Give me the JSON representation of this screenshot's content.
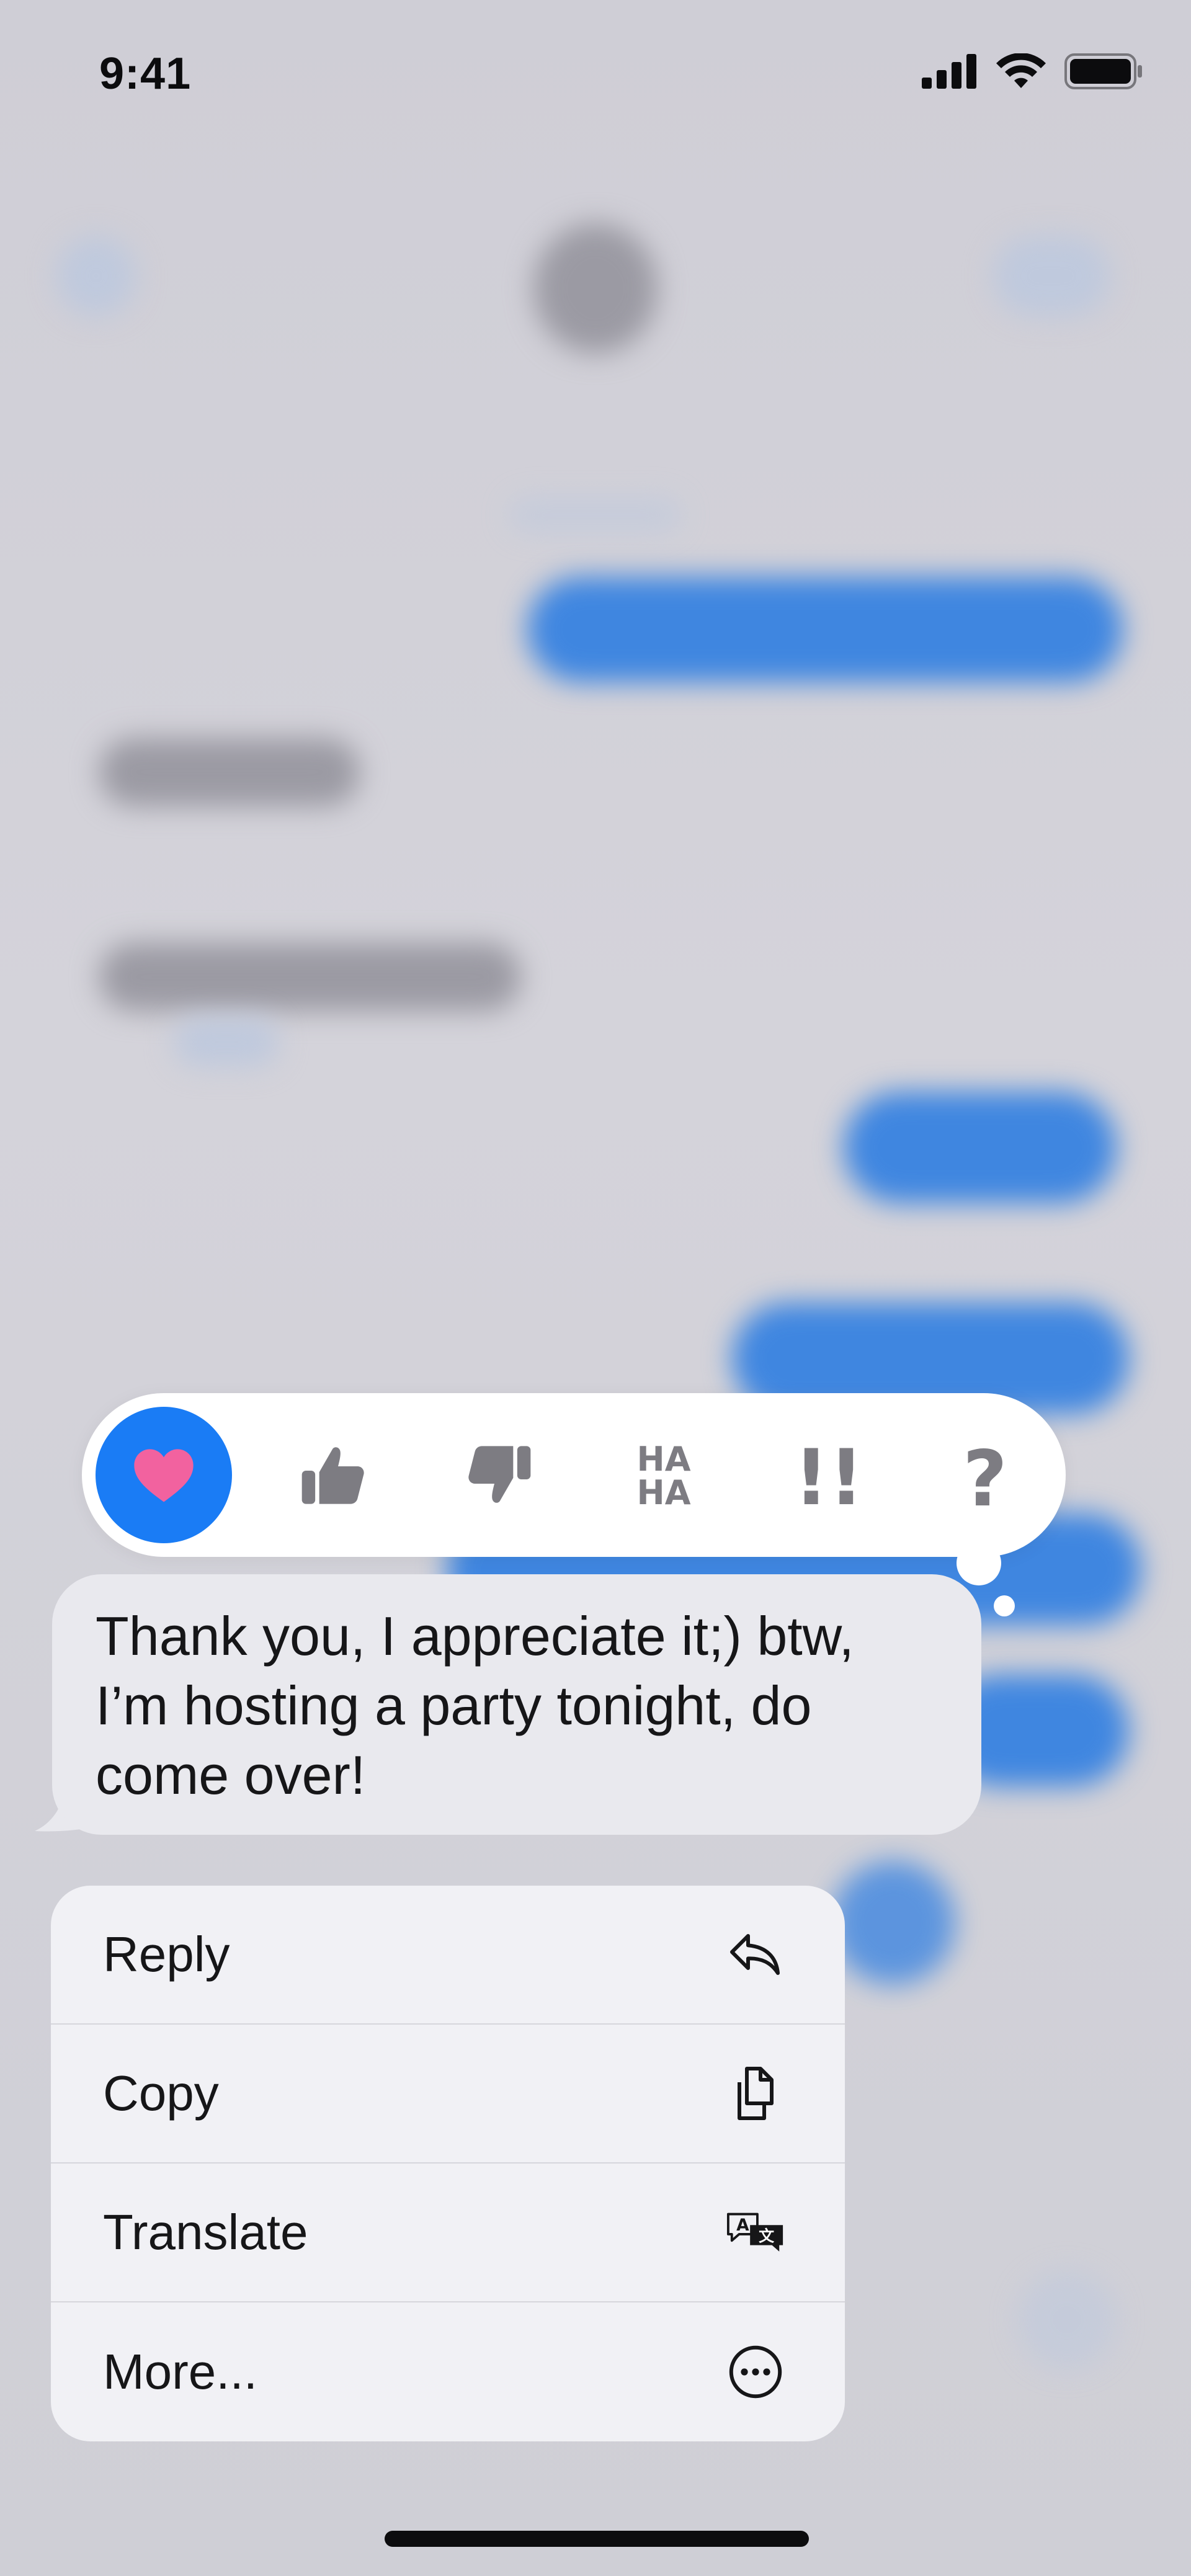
{
  "status_bar": {
    "time": "9:41"
  },
  "reactions": [
    {
      "name": "heart",
      "selected": true
    },
    {
      "name": "thumbs-up",
      "selected": false
    },
    {
      "name": "thumbs-down",
      "selected": false
    },
    {
      "name": "haha",
      "label": "HA HA",
      "selected": false
    },
    {
      "name": "exclamation",
      "label": "!!",
      "selected": false
    },
    {
      "name": "question",
      "label": "?",
      "selected": false
    }
  ],
  "message": {
    "text": "Thank you, I appreciate it;) btw, I’m hosting a party tonight, do come over!"
  },
  "menu": {
    "items": [
      {
        "label": "Reply",
        "icon": "reply-icon"
      },
      {
        "label": "Copy",
        "icon": "copy-icon"
      },
      {
        "label": "Translate",
        "icon": "translate-icon"
      },
      {
        "label": "More...",
        "icon": "more-icon"
      }
    ]
  },
  "colors": {
    "accent": "#1a7cf5",
    "heart": "#f2629f",
    "reaction_gray": "#7d7c82",
    "bubble": "#e9e9ee",
    "menu_bg": "#f1f1f5",
    "background_blue": "#3f86e0"
  }
}
